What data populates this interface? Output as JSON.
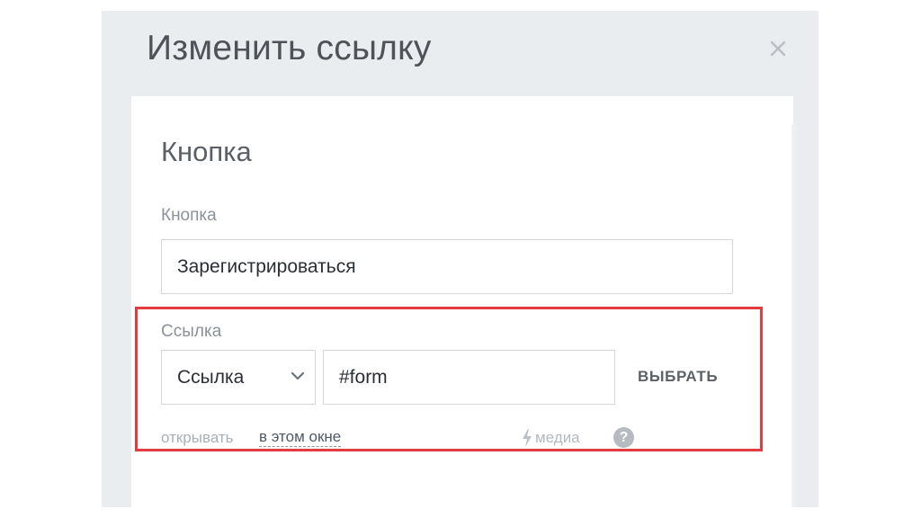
{
  "dialog": {
    "title": "Изменить ссылку"
  },
  "section": {
    "title": "Кнопка"
  },
  "button_field": {
    "label": "Кнопка",
    "value": "Зарегистрироваться"
  },
  "link_field": {
    "label": "Ссылка",
    "type_selected": "Ссылка",
    "value": "#form",
    "choose_label": "ВЫБРАТЬ",
    "open_prefix": "открывать",
    "open_mode": "в этом окне",
    "media_label": "медиа",
    "help_glyph": "?"
  },
  "icons": {
    "close": "close-icon",
    "chevron": "chevron-down-icon",
    "media": "lightning-icon",
    "help": "help-icon"
  },
  "colors": {
    "highlight": "#e33b3f",
    "modal_bg": "#e9edf0"
  }
}
